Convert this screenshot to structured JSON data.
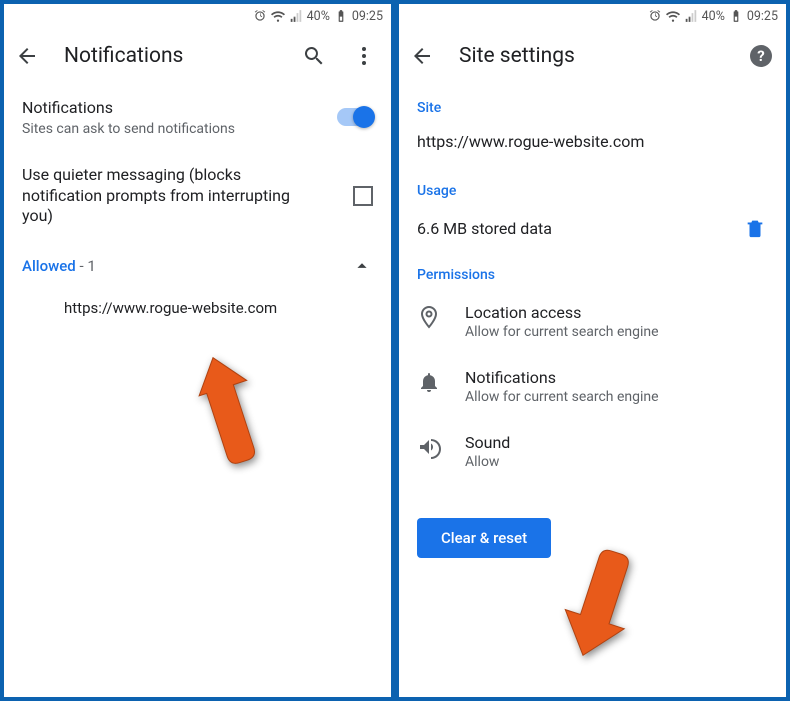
{
  "status": {
    "battery_pct": "40%",
    "time": "09:25"
  },
  "left": {
    "title": "Notifications",
    "notif_label": "Notifications",
    "notif_sub": "Sites can ask to send notifications",
    "quiet_label": "Use quieter messaging (blocks notification prompts from interrupting you)",
    "allowed_word": "Allowed",
    "allowed_count": " - 1",
    "site0": "https://www.rogue-website.com"
  },
  "right": {
    "title": "Site settings",
    "site_head": "Site",
    "site_url": "https://www.rogue-website.com",
    "usage_head": "Usage",
    "usage_text": "6.6 MB stored data",
    "perm_head": "Permissions",
    "perm_loc_t": "Location access",
    "perm_loc_s": "Allow for current search engine",
    "perm_notif_t": "Notifications",
    "perm_notif_s": "Allow for current search engine",
    "perm_sound_t": "Sound",
    "perm_sound_s": "Allow",
    "clear_btn": "Clear & reset"
  }
}
